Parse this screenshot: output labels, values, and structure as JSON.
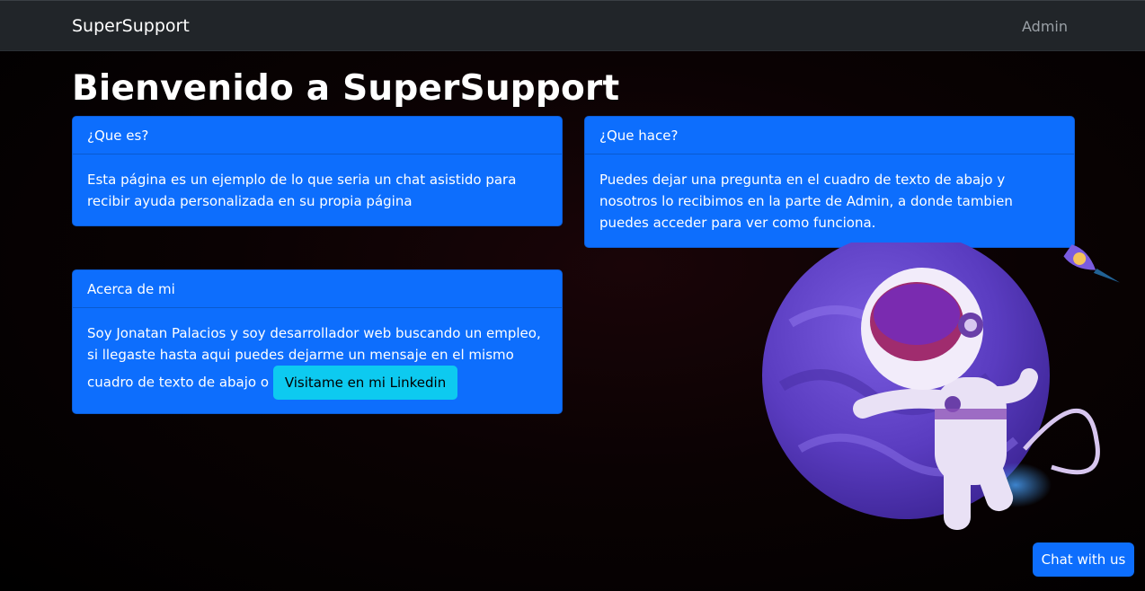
{
  "navbar": {
    "brand": "SuperSupport",
    "admin_label": "Admin"
  },
  "page": {
    "title": "Bienvenido a SuperSupport"
  },
  "cards": [
    {
      "header": "¿Que es?",
      "body": "Esta página es un ejemplo de lo que seria un chat asistido para recibir ayuda personalizada en su propia página"
    },
    {
      "header": "¿Que hace?",
      "body": "Puedes dejar una pregunta en el cuadro de texto de abajo y nosotros lo recibimos en la parte de Admin, a donde tambien puedes acceder para ver como funciona."
    },
    {
      "header": "Acerca de mi",
      "body": "Soy Jonatan Palacios y soy desarrollador web buscando un empleo, si llegaste hasta aqui puedes dejarme un mensaje en el mismo cuadro de texto de abajo o",
      "button_label": "Visitame en mi Linkedin"
    }
  ],
  "chat": {
    "button_label": "Chat with us"
  },
  "colors": {
    "primary": "#0d6efd",
    "info": "#0dcaf0",
    "navbar": "#212529",
    "planet": "#5b3fc4"
  },
  "illustration": {
    "icons": [
      "planet-icon",
      "astronaut-icon",
      "rocket-icon"
    ]
  }
}
